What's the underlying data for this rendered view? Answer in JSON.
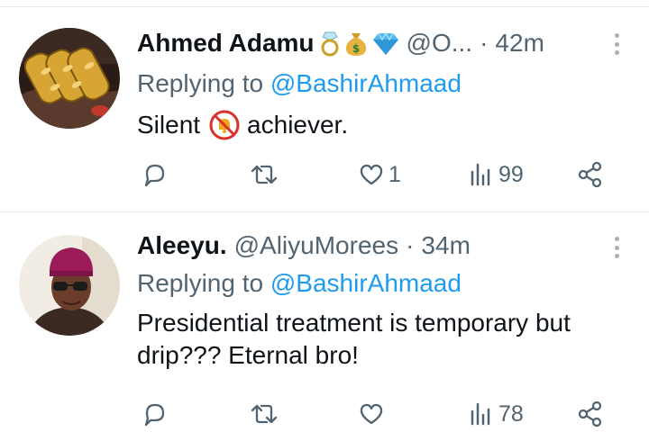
{
  "tweets": [
    {
      "name": "Ahmed Adamu",
      "name_emojis": [
        "ring",
        "money-bag",
        "gem"
      ],
      "handle": "@O...",
      "separator": "·",
      "time": "42m",
      "reply_prefix": "Replying to",
      "reply_to": "@BashirAhmaad",
      "text_before": "Silent",
      "text_emoji": "no-bell",
      "text_after": "achiever.",
      "likes": "1",
      "views": "99"
    },
    {
      "name": "Aleeyu.",
      "handle": "@AliyuMorees",
      "separator": "·",
      "time": "34m",
      "reply_prefix": "Replying to",
      "reply_to": "@BashirAhmaad",
      "text": "Presidential treatment is temporary but drip??? Eternal bro!",
      "likes": "",
      "views": "78"
    }
  ],
  "icons": {
    "reply": "speech-bubble-icon",
    "retweet": "retweet-icon",
    "like": "heart-icon",
    "views": "bar-chart-icon",
    "share": "share-icon",
    "more": "vertical-ellipsis-icon"
  },
  "colors": {
    "text": "#0f1419",
    "secondary": "#536471",
    "link": "#1d9bf0",
    "divider": "#e6e9ec"
  }
}
